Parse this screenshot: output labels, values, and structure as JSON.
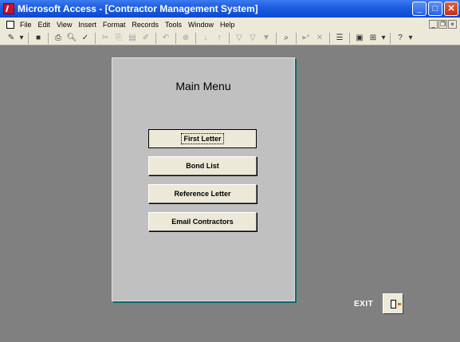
{
  "window": {
    "title": "Microsoft Access - [Contractor Management System]"
  },
  "menubar": {
    "items": [
      "File",
      "Edit",
      "View",
      "Insert",
      "Format",
      "Records",
      "Tools",
      "Window",
      "Help"
    ]
  },
  "toolbar": {
    "icons": [
      "design-view-icon",
      "dropdown-arrow-icon",
      "save-icon",
      "print-icon",
      "print-preview-icon",
      "spelling-icon",
      "cut-icon",
      "copy-icon",
      "paste-icon",
      "format-painter-icon",
      "undo-icon",
      "insert-hyperlink-icon",
      "sort-ascending-icon",
      "sort-descending-icon",
      "filter-by-selection-icon",
      "filter-by-form-icon",
      "apply-filter-icon",
      "find-icon",
      "new-record-icon",
      "delete-record-icon",
      "properties-icon",
      "database-window-icon",
      "new-object-icon",
      "help-icon"
    ]
  },
  "form": {
    "title": "Main Menu",
    "buttons": {
      "first_letter": "First Letter",
      "bond_list": "Bond List",
      "reference_letter": "Reference Letter",
      "email_contractors": "Email Contractors"
    }
  },
  "exit": {
    "label": "EXIT"
  },
  "colors": {
    "workspace": "#808080",
    "form_bg": "#c0c0c0",
    "form_shadow": "#0e6a6a",
    "title_bar": "#0a49d3"
  }
}
